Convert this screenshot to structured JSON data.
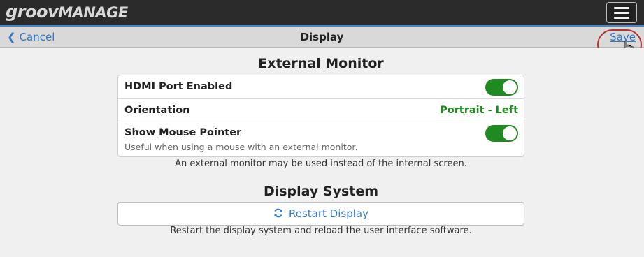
{
  "app": {
    "logo_primary": "groov",
    "logo_secondary": "MANAGE"
  },
  "header": {
    "cancel_label": "Cancel",
    "title": "Display",
    "save_label": "Save"
  },
  "external_monitor": {
    "title": "External Monitor",
    "rows": [
      {
        "label": "HDMI Port Enabled",
        "toggle_on": true
      },
      {
        "label": "Orientation",
        "value": "Portrait - Left"
      },
      {
        "label": "Show Mouse Pointer",
        "sublabel": "Useful when using a mouse with an external monitor.",
        "toggle_on": true
      }
    ],
    "note": "An external monitor may be used instead of the internal screen."
  },
  "display_system": {
    "title": "Display System",
    "button_label": "Restart Display",
    "note": "Restart the display system and reload the user interface software."
  },
  "colors": {
    "toggle_on": "#1f8a1f",
    "link": "#3478c6",
    "highlight": "#b83232",
    "topbar": "#2b2b2b"
  }
}
